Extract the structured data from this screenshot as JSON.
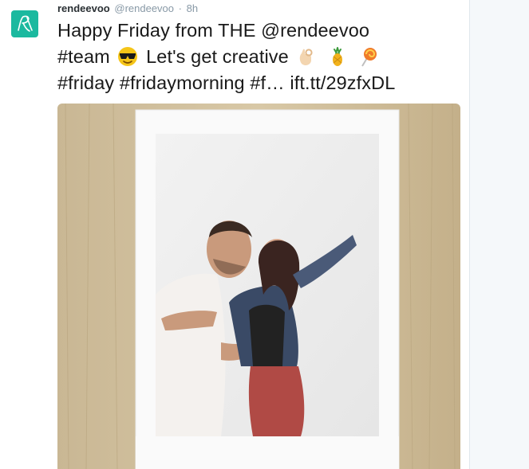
{
  "tweet": {
    "fullname": "rendeevoo",
    "username": "@rendeevoo",
    "separator": "·",
    "timestamp": "8h",
    "line1": "Happy Friday from THE @rendeevoo",
    "line2a": "#team",
    "line2b": "Let's get creative",
    "line3": "#friday #fridaymorning #f…",
    "link": "ift.tt/29zfxDL"
  },
  "icons": {
    "avatar": "rendeevoo-logo-icon",
    "emoji1": "sunglasses-emoji-icon",
    "emoji2": "ok-hand-emoji-icon",
    "emoji3": "pineapple-emoji-icon",
    "emoji4": "lollipop-emoji-icon"
  },
  "colors": {
    "brand": "#1bb99f",
    "text": "#1a1a1a",
    "meta": "#8899a6"
  }
}
